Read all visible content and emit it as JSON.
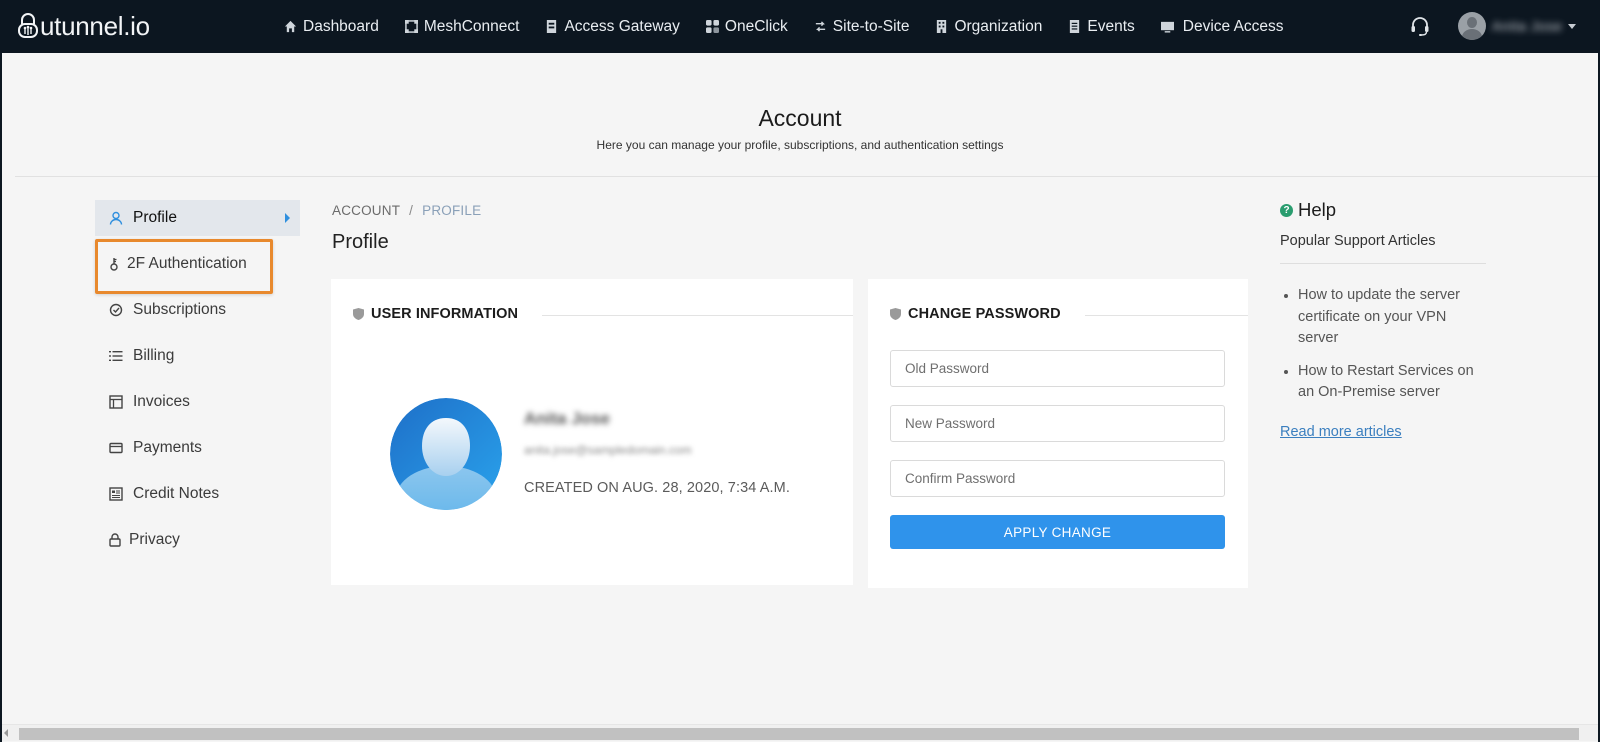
{
  "brand": {
    "name": "utunnel.io"
  },
  "nav": {
    "items": [
      {
        "label": "Dashboard",
        "icon": "home-icon"
      },
      {
        "label": "MeshConnect",
        "icon": "mesh-icon"
      },
      {
        "label": "Access Gateway",
        "icon": "gateway-icon"
      },
      {
        "label": "OneClick",
        "icon": "grid-icon"
      },
      {
        "label": "Site-to-Site",
        "icon": "arrows-icon"
      },
      {
        "label": "Organization",
        "icon": "building-icon"
      },
      {
        "label": "Events",
        "icon": "list-icon"
      },
      {
        "label": "Device Access",
        "icon": "monitor-icon"
      }
    ],
    "user_name": "Anita Jose"
  },
  "header": {
    "title": "Account",
    "subtitle": "Here you can manage your profile, subscriptions, and authentication settings"
  },
  "sidebar": {
    "items": [
      {
        "label": "Profile",
        "icon": "user-icon",
        "active": true
      },
      {
        "label": "2F Authentication",
        "icon": "key-icon"
      },
      {
        "label": "Subscriptions",
        "icon": "check-circle-icon"
      },
      {
        "label": "Billing",
        "icon": "list-icon"
      },
      {
        "label": "Invoices",
        "icon": "invoice-icon"
      },
      {
        "label": "Payments",
        "icon": "card-icon"
      },
      {
        "label": "Credit Notes",
        "icon": "id-card-icon"
      },
      {
        "label": "Privacy",
        "icon": "lock-icon"
      }
    ],
    "highlighted": "2F Authentication",
    "highlight_color": "#e8892d"
  },
  "breadcrumb": {
    "root": "ACCOUNT",
    "separator": "/",
    "current": "PROFILE"
  },
  "main": {
    "title": "Profile",
    "user_info": {
      "heading": "USER INFORMATION",
      "name": "Anita Jose",
      "email": "anita.jose@sampledomain.com",
      "created": "CREATED ON AUG. 28, 2020, 7:34 A.M."
    },
    "change_password": {
      "heading": "CHANGE PASSWORD",
      "old_placeholder": "Old Password",
      "new_placeholder": "New Password",
      "confirm_placeholder": "Confirm Password",
      "apply_label": "APPLY CHANGE",
      "button_color": "#2f93eb"
    }
  },
  "help": {
    "title": "Help",
    "subtitle": "Popular Support Articles",
    "articles": [
      "How to update the server certificate on your VPN server",
      "How to Restart Services on an On-Premise server"
    ],
    "more_label": "Read more articles"
  }
}
